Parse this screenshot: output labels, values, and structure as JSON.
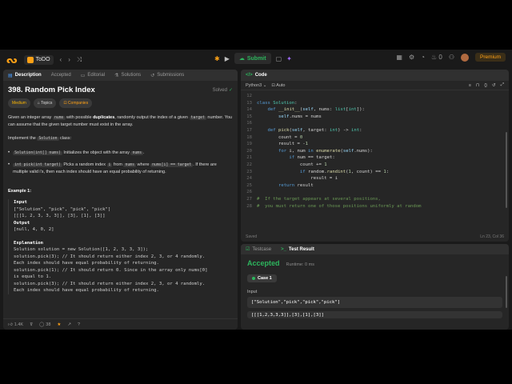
{
  "topnav": {
    "list_label": "ToDO",
    "submit_label": "Submit",
    "premium_label": "Premium",
    "counter": "0"
  },
  "left": {
    "tabs": [
      "Description",
      "Accepted",
      "Editorial",
      "Solutions",
      "Submissions"
    ],
    "title": "398. Random Pick Index",
    "solved": "Solved",
    "pills": {
      "difficulty": "Medium",
      "topics": "Topics",
      "companies": "Companies"
    },
    "desc1_a": "Given an integer array ",
    "desc1_nums": "nums",
    "desc1_b": " with possible ",
    "desc1_dup": "duplicates",
    "desc1_c": ", randomly output the index of a given ",
    "desc1_target": "target",
    "desc1_d": " number. You can assume that the given target number must exist in the array.",
    "desc2_a": "Implement the ",
    "desc2_cls": "Solution",
    "desc2_b": " class:",
    "b1_code": "Solution(int[] nums)",
    "b1_a": " Initializes the object with the array ",
    "b1_nums": "nums",
    "b1_b": ".",
    "b2_code": "int pick(int target)",
    "b2_a": " Picks a random index ",
    "b2_i": "i",
    "b2_b": " from ",
    "b2_nums": "nums",
    "b2_c": " where ",
    "b2_eq": "nums[i] == target",
    "b2_d": ". If there are multiple valid i's, then each index should have an equal probability of returning.",
    "example_h": "Example 1:",
    "ex_input_lbl": "Input",
    "ex_input_1": "[\"Solution\", \"pick\", \"pick\", \"pick\"]",
    "ex_input_2": "[[[1, 2, 3, 3, 3]], [3], [1], [3]]",
    "ex_output_lbl": "Output",
    "ex_output": "[null, 4, 0, 2]",
    "ex_expl_lbl": "Explanation",
    "ex_expl": [
      "Solution solution = new Solution([1, 2, 3, 3, 3]);",
      "solution.pick(3); // It should return either index 2, 3, or 4 randomly.",
      "Each index should have equal probability of returning.",
      "solution.pick(1); // It should return 0. Since in the array only nums[0]",
      "is equal to 1.",
      "solution.pick(3); // It should return either index 2, 3, or 4 randomly.",
      "Each index should have equal probability of returning."
    ],
    "likes": "1.4K",
    "comments": "38"
  },
  "code": {
    "tab": "Code",
    "language": "Python3",
    "auto": "Auto",
    "saved": "Saved",
    "cursor": "Ln 23, Col 36",
    "line_numbers": [
      "12",
      "13",
      "14",
      "15",
      "16",
      "17",
      "18",
      "19",
      "20",
      "21",
      "22",
      "23",
      "24",
      "25",
      "26",
      "27",
      "28"
    ]
  },
  "test": {
    "tabs": [
      "Testcase",
      "Test Result"
    ],
    "status": "Accepted",
    "runtime": "Runtime: 0 ms",
    "case": "Case 1",
    "input_label": "Input",
    "input_1": "[\"Solution\",\"pick\",\"pick\",\"pick\"]",
    "input_2": "[[[1,2,3,3,3]],[3],[1],[3]]"
  }
}
